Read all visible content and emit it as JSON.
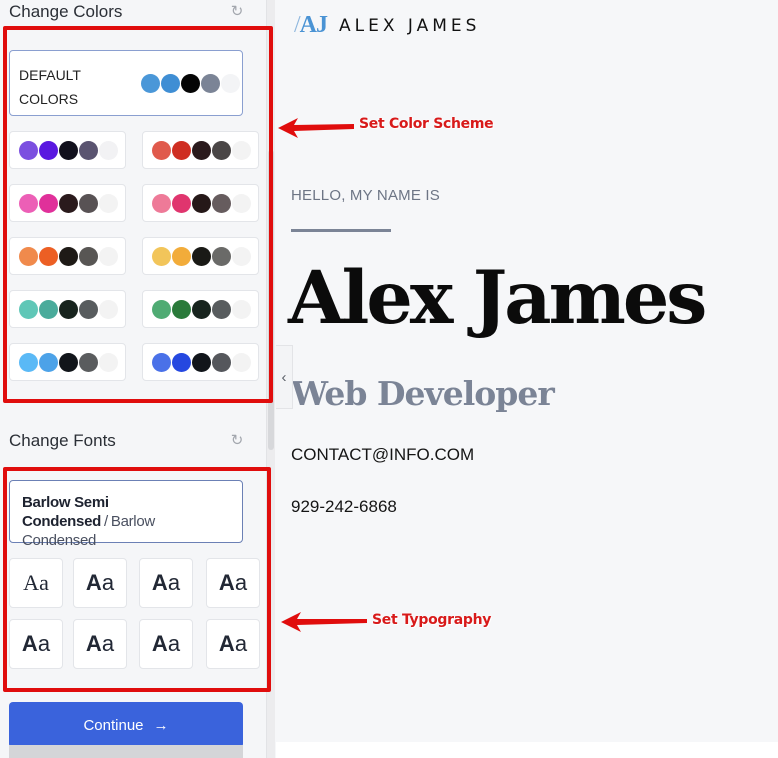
{
  "sidebar": {
    "colors_section": {
      "title": "Change Colors",
      "reset_icon": "reset-icon"
    },
    "default_scheme": {
      "label": "DEFAULT COLORS",
      "colors": [
        "#4a97d8",
        "#3f8ed4",
        "#050505",
        "#7b8496",
        "#f3f4f6"
      ]
    },
    "color_schemes": [
      {
        "colors": [
          "#7b4fe0",
          "#5a18e0",
          "#11101c",
          "#5a5470",
          "#f2f2f4"
        ]
      },
      {
        "colors": [
          "#e05a4c",
          "#cf2e22",
          "#2a1a1c",
          "#4a4646",
          "#f3f3f3"
        ]
      },
      {
        "colors": [
          "#ec5fb6",
          "#e0309a",
          "#2a1a1c",
          "#585254",
          "#f3f3f3"
        ]
      },
      {
        "colors": [
          "#ee7a98",
          "#e0356e",
          "#251818",
          "#665c5e",
          "#f3f3f3"
        ]
      },
      {
        "colors": [
          "#f08a4c",
          "#ec5f24",
          "#1e1a16",
          "#585654",
          "#f3f3f3"
        ]
      },
      {
        "colors": [
          "#f2c55a",
          "#f2ac3a",
          "#1a1a16",
          "#6a6a68",
          "#f3f3f3"
        ]
      },
      {
        "colors": [
          "#5fc7b7",
          "#4aab9b",
          "#18241e",
          "#585c5e",
          "#f3f3f3"
        ]
      },
      {
        "colors": [
          "#4fab73",
          "#2a7a3a",
          "#18241e",
          "#585c5e",
          "#f3f3f3"
        ]
      },
      {
        "colors": [
          "#5ab9f6",
          "#4ca2e8",
          "#11151a",
          "#5a5c5e",
          "#f3f3f3"
        ]
      },
      {
        "colors": [
          "#4a71e8",
          "#2548e0",
          "#11151a",
          "#55575c",
          "#f3f3f3"
        ]
      }
    ],
    "fonts_section": {
      "title": "Change Fonts",
      "reset_icon": "reset-icon"
    },
    "selected_font": {
      "primary": "Barlow Semi Condensed",
      "separator": "/",
      "secondary": "Barlow Condensed"
    },
    "font_tiles": [
      {
        "label_big": "A",
        "label_small": "a",
        "style": "serif"
      },
      {
        "label_big": "A",
        "label_small": "a",
        "style": "sans-bold"
      },
      {
        "label_big": "A",
        "label_small": "a",
        "style": "sans-bold"
      },
      {
        "label_big": "A",
        "label_small": "a",
        "style": "sans-bold"
      },
      {
        "label_big": "A",
        "label_small": "a",
        "style": "sans-bold"
      },
      {
        "label_big": "A",
        "label_small": "a",
        "style": "sans-semi"
      },
      {
        "label_big": "A",
        "label_small": "a",
        "style": "sans-semi"
      },
      {
        "label_big": "A",
        "label_small": "a",
        "style": "sans-bold"
      }
    ],
    "continue_button": {
      "label": "Continue",
      "icon": "arrow-right-icon"
    }
  },
  "annotations": {
    "color_scheme": "Set Color Scheme",
    "typography": "Set Typography",
    "color": "#e00d0d"
  },
  "preview": {
    "logo_mark_slash": "/",
    "logo_mark": "AJ",
    "logo_name": "ALEX JAMES",
    "greeting": "HELLO, MY NAME IS",
    "name": "Alex James",
    "role": "Web Developer",
    "email": "CONTACT@INFO.COM",
    "phone": "929-242-6868",
    "accent_color": "#4a93d4",
    "muted_color": "#7b8496"
  }
}
